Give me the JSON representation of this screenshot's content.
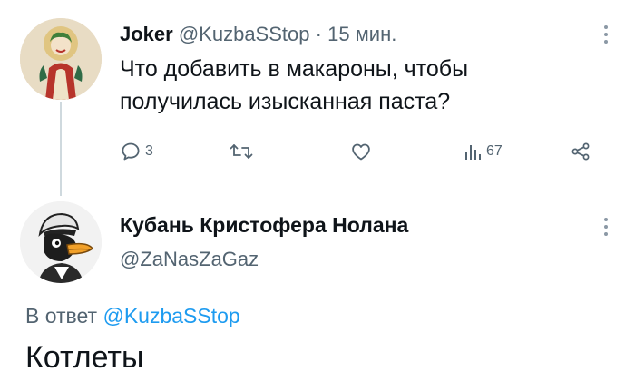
{
  "tweet1": {
    "name": "Joker",
    "handle": "@KuzbaSStop",
    "separator": "·",
    "time": "15 мин.",
    "text": "Что добавить в макароны, чтобы получилась изысканная паста?",
    "avatar_icon": "joker-avatar",
    "actions": {
      "reply_count": "3",
      "retweet_count": "",
      "like_count": "",
      "views_count": "67"
    }
  },
  "tweet2": {
    "name": "Кубань Кристофера Нолана",
    "handle": "@ZaNasZaGaz",
    "avatar_icon": "duck-avatar",
    "reply_prefix": "В ответ",
    "reply_handle": "@KuzbaSStop",
    "text": "Котлеты"
  },
  "colors": {
    "text": "#0f1419",
    "secondary": "#536471",
    "link": "#1d9bf0",
    "thread_line": "#cfd9de"
  }
}
